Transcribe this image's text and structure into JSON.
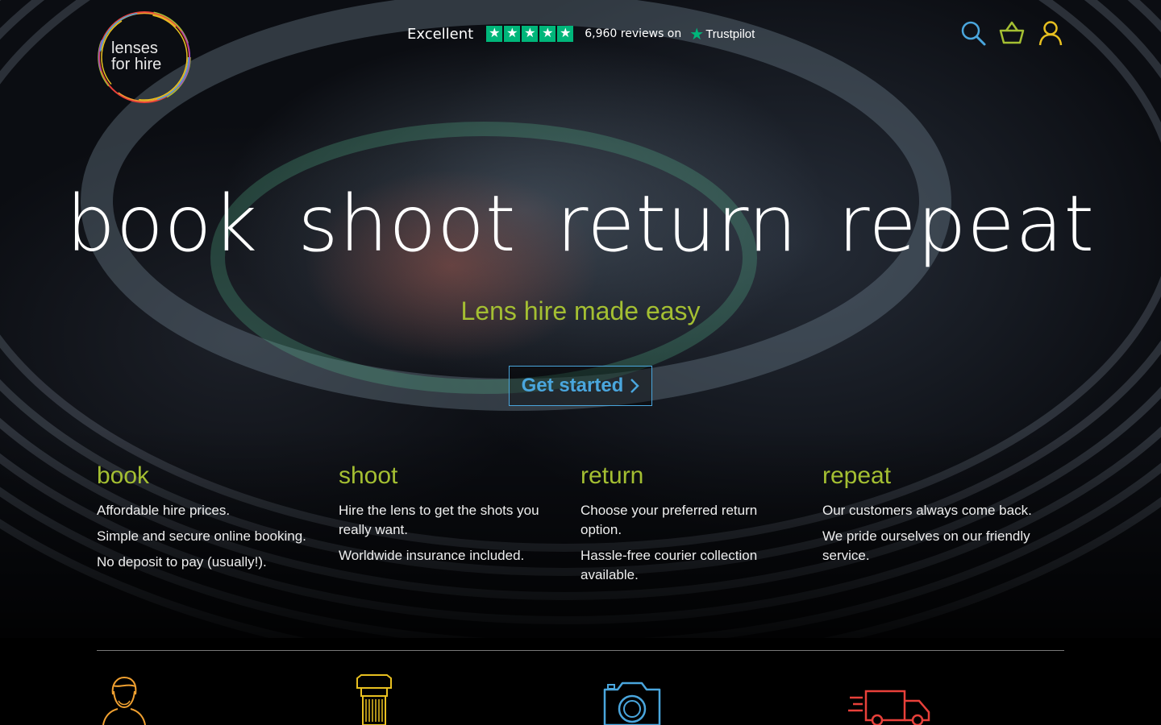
{
  "brand": {
    "logo_line1": "lenses",
    "logo_line2": "for hire"
  },
  "trustpilot": {
    "rating_word": "Excellent",
    "stars": 5,
    "review_count": "6,960 reviews on",
    "provider": "Trustpilot",
    "color": "#00b67a"
  },
  "header_icons": [
    "search-icon",
    "basket-icon",
    "account-icon"
  ],
  "hero": {
    "headline": "book  shoot  return  repeat",
    "tagline": "Lens hire made easy",
    "cta_label": "Get started"
  },
  "steps": [
    {
      "title": "book",
      "lines": [
        "Affordable hire prices.",
        "Simple and secure online booking.",
        "No deposit to pay (usually!)."
      ]
    },
    {
      "title": "shoot",
      "lines": [
        "Hire the lens to get the shots you really want.",
        "Worldwide insurance included."
      ]
    },
    {
      "title": "return",
      "lines": [
        "Choose your preferred return option.",
        "Hassle-free courier collection available."
      ]
    },
    {
      "title": "repeat",
      "lines": [
        "Our customers always come back.",
        "We pride ourselves on our friendly service."
      ]
    }
  ],
  "feature_icons": [
    "person-icon",
    "lens-icon",
    "camera-icon",
    "delivery-truck-icon"
  ],
  "colors": {
    "accent_green": "#a4bf32",
    "accent_blue": "#4aa6dd",
    "icon_orange": "#f0a030",
    "icon_yellow": "#e8c020",
    "icon_red": "#e8403a"
  }
}
